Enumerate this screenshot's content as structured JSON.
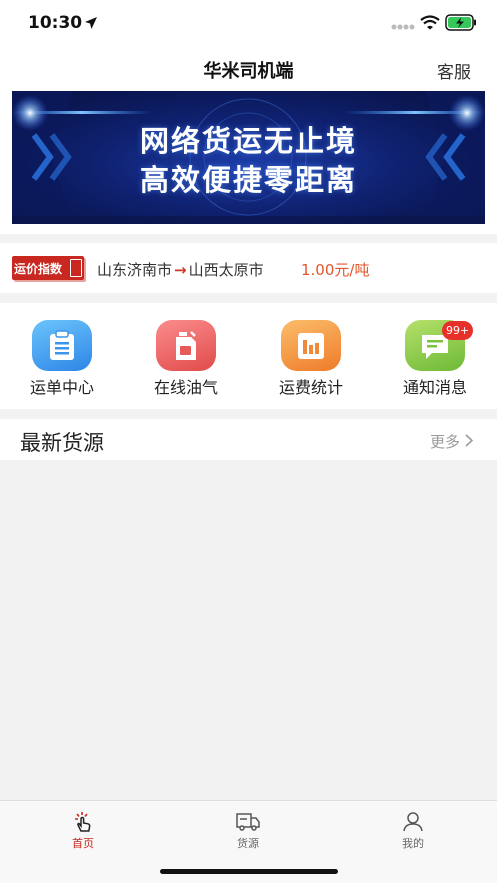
{
  "status": {
    "time": "10:30",
    "icons": [
      "location-arrow-icon",
      "signal-icon",
      "wifi-icon",
      "battery-charging-icon"
    ]
  },
  "header": {
    "title": "华米司机端",
    "service_label": "客服"
  },
  "banner": {
    "line1": "网络货运无止境",
    "line2": "高效便捷零距离"
  },
  "freight_index": {
    "badge_label": "运价指数",
    "from_city": "山东济南市",
    "to_city": "山西太原市",
    "arrow": "→",
    "price": "1.00元/吨"
  },
  "shortcuts": [
    {
      "label": "运单中心",
      "icon": "clipboard-icon"
    },
    {
      "label": "在线油气",
      "icon": "fuel-can-icon"
    },
    {
      "label": "运费统计",
      "icon": "bar-chart-icon"
    },
    {
      "label": "通知消息",
      "icon": "message-icon",
      "badge": "99+"
    }
  ],
  "latest_cargo": {
    "title": "最新货源",
    "more_label": "更多",
    "more_icon": "chevron-right-icon"
  },
  "tabbar": {
    "tabs": [
      {
        "label": "首页",
        "icon": "tap-hand-icon",
        "active": true
      },
      {
        "label": "货源",
        "icon": "truck-icon",
        "active": false
      },
      {
        "label": "我的",
        "icon": "user-icon",
        "active": false
      }
    ]
  },
  "colors": {
    "accent_red": "#c8281f",
    "price_orange": "#e2562c",
    "banner_blue": "#0f2170",
    "page_background": "#f2f2f2"
  }
}
